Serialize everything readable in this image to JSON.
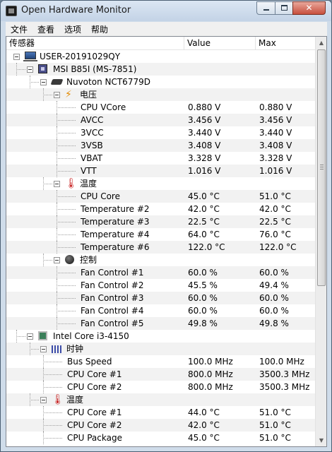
{
  "window": {
    "title": "Open Hardware Monitor"
  },
  "menu": [
    "文件",
    "查看",
    "选项",
    "帮助"
  ],
  "columns": {
    "sensor": "传感器",
    "value": "Value",
    "max": "Max"
  },
  "rows": [
    {
      "label": "USER-20191029QY",
      "value": "",
      "max": "",
      "icon": "computer-icon",
      "expander": true
    },
    {
      "label": "MSI B85I (MS-7851)",
      "value": "",
      "max": "",
      "icon": "motherboard-icon",
      "expander": true
    },
    {
      "label": "Nuvoton NCT6779D",
      "value": "",
      "max": "",
      "icon": "chip-icon",
      "expander": true
    },
    {
      "label": "电压",
      "value": "",
      "max": "",
      "icon": "voltage-icon",
      "expander": true
    },
    {
      "label": "CPU VCore",
      "value": "0.880 V",
      "max": "0.880 V"
    },
    {
      "label": "AVCC",
      "value": "3.456 V",
      "max": "3.456 V"
    },
    {
      "label": "3VCC",
      "value": "3.440 V",
      "max": "3.440 V"
    },
    {
      "label": "3VSB",
      "value": "3.408 V",
      "max": "3.408 V"
    },
    {
      "label": "VBAT",
      "value": "3.328 V",
      "max": "3.328 V"
    },
    {
      "label": "VTT",
      "value": "1.016 V",
      "max": "1.016 V"
    },
    {
      "label": "温度",
      "value": "",
      "max": "",
      "icon": "thermometer-icon",
      "expander": true
    },
    {
      "label": "CPU Core",
      "value": "45.0 °C",
      "max": "51.0 °C"
    },
    {
      "label": "Temperature #2",
      "value": "42.0 °C",
      "max": "42.0 °C"
    },
    {
      "label": "Temperature #3",
      "value": "22.5 °C",
      "max": "22.5 °C"
    },
    {
      "label": "Temperature #4",
      "value": "64.0 °C",
      "max": "76.0 °C"
    },
    {
      "label": "Temperature #6",
      "value": "122.0 °C",
      "max": "122.0 °C"
    },
    {
      "label": "控制",
      "value": "",
      "max": "",
      "icon": "fan-icon",
      "expander": true
    },
    {
      "label": "Fan Control #1",
      "value": "60.0 %",
      "max": "60.0 %"
    },
    {
      "label": "Fan Control #2",
      "value": "45.5 %",
      "max": "49.4 %"
    },
    {
      "label": "Fan Control #3",
      "value": "60.0 %",
      "max": "60.0 %"
    },
    {
      "label": "Fan Control #4",
      "value": "60.0 %",
      "max": "60.0 %"
    },
    {
      "label": "Fan Control #5",
      "value": "49.8 %",
      "max": "49.8 %"
    },
    {
      "label": "Intel Core i3-4150",
      "value": "",
      "max": "",
      "icon": "cpu-icon",
      "expander": true
    },
    {
      "label": "时钟",
      "value": "",
      "max": "",
      "icon": "clock-icon",
      "expander": true
    },
    {
      "label": "Bus Speed",
      "value": "100.0 MHz",
      "max": "100.0 MHz"
    },
    {
      "label": "CPU Core #1",
      "value": "800.0 MHz",
      "max": "3500.3 MHz"
    },
    {
      "label": "CPU Core #2",
      "value": "800.0 MHz",
      "max": "3500.3 MHz"
    },
    {
      "label": "温度",
      "value": "",
      "max": "",
      "icon": "thermometer-icon",
      "expander": true
    },
    {
      "label": "CPU Core #1",
      "value": "44.0 °C",
      "max": "51.0 °C"
    },
    {
      "label": "CPU Core #2",
      "value": "42.0 °C",
      "max": "51.0 °C"
    },
    {
      "label": "CPU Package",
      "value": "45.0 °C",
      "max": "51.0 °C"
    }
  ]
}
